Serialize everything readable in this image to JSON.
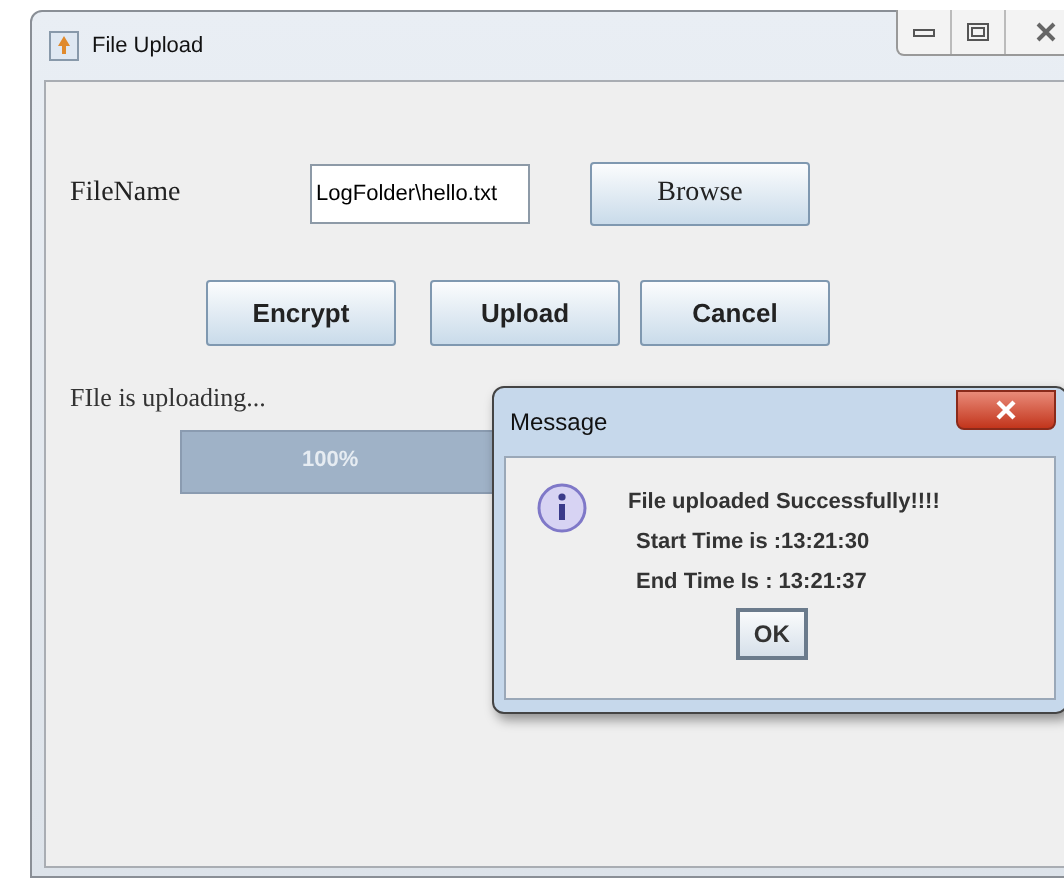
{
  "window": {
    "title": "File Upload"
  },
  "form": {
    "file_label": "FileName",
    "file_value": "LogFolder\\hello.txt",
    "browse_button": "Browse"
  },
  "buttons": [
    {
      "label": "Encrypt"
    },
    {
      "label": "Upload"
    },
    {
      "label": "Cancel"
    }
  ],
  "status": "FIle is uploading...",
  "progress": {
    "level": 1.0,
    "reading": "100%"
  },
  "dialog": {
    "title": "Message",
    "lines": [
      "File uploaded  Successfully!!!!",
      "Start Time is :13:21:30",
      "End Time Is : 13:21:37"
    ],
    "button": "OK"
  }
}
